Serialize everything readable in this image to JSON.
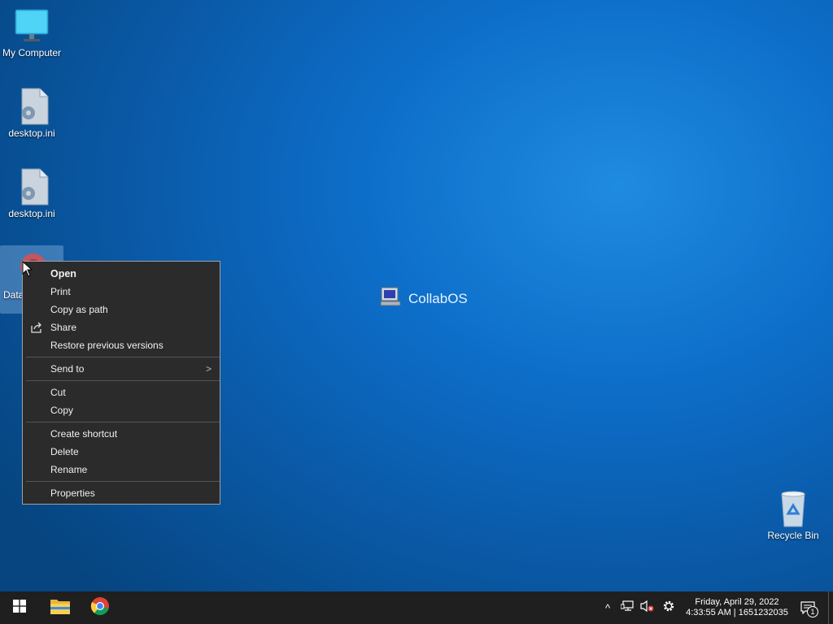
{
  "desktop": {
    "icons": [
      {
        "label": "My Computer",
        "icon": "monitor-icon"
      },
      {
        "label": "desktop.ini",
        "icon": "settings-file-icon"
      },
      {
        "label": "desktop.ini",
        "icon": "settings-file-icon"
      },
      {
        "label": "Data",
        "icon": "shortcut-icon"
      },
      {
        "label": "Recycle Bin",
        "icon": "recycle-bin-icon"
      }
    ],
    "center_label": "CollabOS"
  },
  "context_menu": {
    "open": "Open",
    "print": "Print",
    "copy_as_path": "Copy as path",
    "share": "Share",
    "restore": "Restore previous versions",
    "send_to": "Send to",
    "send_to_arrow": ">",
    "cut": "Cut",
    "copy": "Copy",
    "create_shortcut": "Create shortcut",
    "delete": "Delete",
    "rename": "Rename",
    "properties": "Properties"
  },
  "taskbar": {
    "clock_date": "Friday, April 29, 2022",
    "clock_time": "4:33:55 AM | 1651232035",
    "notification_count": "1",
    "tray_chevron": "^"
  },
  "colors": {
    "taskbar_bg": "#1f1f1f",
    "menu_bg": "#2b2b2b",
    "desktop_accent": "#0d6ec9"
  }
}
